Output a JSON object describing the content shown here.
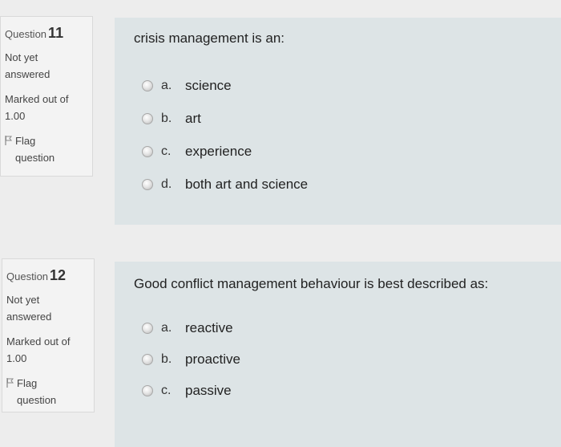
{
  "questions": [
    {
      "label": "Question",
      "number": "11",
      "state": "Not yet answered",
      "grade": "Marked out of 1.00",
      "flag_label": "Flag question",
      "text": "crisis management is an:",
      "answers": [
        {
          "letter": "a.",
          "text": "science"
        },
        {
          "letter": "b.",
          "text": "art"
        },
        {
          "letter": "c.",
          "text": "experience"
        },
        {
          "letter": "d.",
          "text": "both art and science"
        }
      ]
    },
    {
      "label": "Question",
      "number": "12",
      "state": "Not yet answered",
      "grade": "Marked out of 1.00",
      "flag_label": "Flag question",
      "text": "Good conflict management behaviour is best described as:",
      "answers": [
        {
          "letter": "a.",
          "text": "reactive"
        },
        {
          "letter": "b.",
          "text": "proactive"
        },
        {
          "letter": "c.",
          "text": "passive"
        }
      ]
    }
  ],
  "colors": {
    "info_bg": "#f3f3f3",
    "formulation_bg": "#dde4e6",
    "page_bg": "#ededed"
  }
}
